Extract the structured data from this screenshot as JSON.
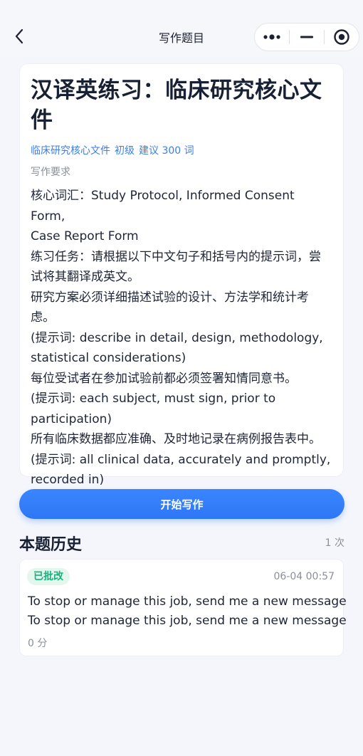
{
  "nav": {
    "title": "写作题目"
  },
  "capsule": {
    "icons": [
      "more-dots-icon",
      "minimize-icon",
      "close-target-icon"
    ]
  },
  "prompt": {
    "title": "汉译英练习：临床研究核心文件",
    "meta": {
      "category": "临床研究核心文件",
      "level": "初级",
      "suggestion": "建议 300 词"
    },
    "requirement_label": "写作要求",
    "lines": [
      "核心词汇：Study Protocol, Informed Consent Form,",
      "Case Report Form",
      "练习任务：请根据以下中文句子和括号内的提示词，尝",
      "试将其翻译成英文。",
      "研究方案必须详细描述试验的设计、方法学和统计考",
      "虑。",
      "(提示词: describe in detail, design, methodology,",
      "statistical considerations)",
      "每位受试者在参加试验前都必须签署知情同意书。",
      "(提示词: each subject, must sign, prior to",
      "participation)",
      "所有临床数据都应准确、及时地记录在病例报告表中。",
      "(提示词: all clinical data, accurately and promptly,",
      "recorded in)"
    ]
  },
  "start_button": {
    "label": "开始写作"
  },
  "history": {
    "title": "本题历史",
    "count": "1 次",
    "items": [
      {
        "status": "已批改",
        "time": "06-04 00:57",
        "lines": [
          "To stop or manage this job, send me a new message",
          "To stop or manage this job, send me a new message"
        ],
        "score": "0 分"
      }
    ]
  },
  "colors": {
    "accent": "#2e76f5",
    "meta_link": "#3a7fe6",
    "badge_text": "#18b37a",
    "badge_bg": "#e3f7ef",
    "background": "#f4f6fb"
  }
}
